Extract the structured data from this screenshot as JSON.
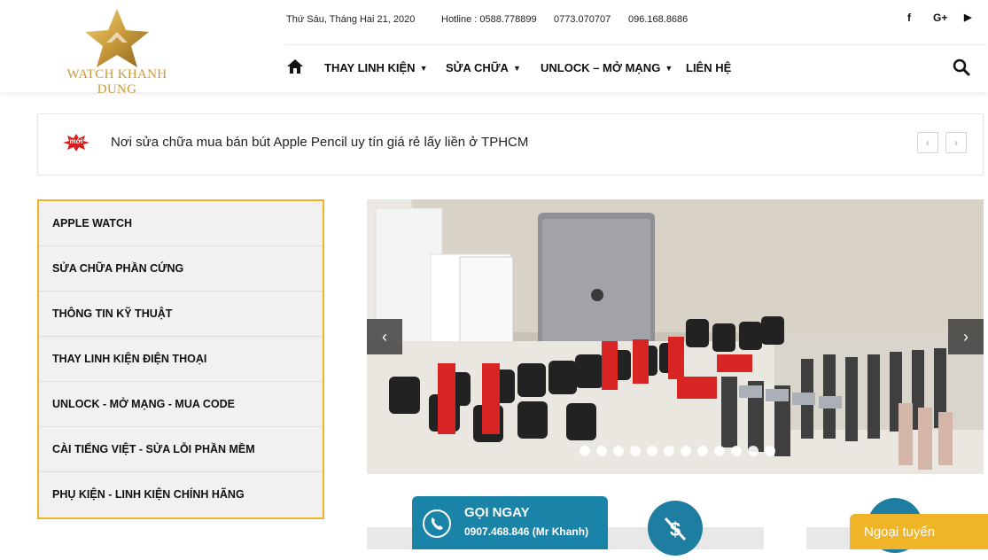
{
  "brand": {
    "logo_text": "WATCH KHANH DUNG"
  },
  "topbar": {
    "date": "Thứ Sáu, Tháng Hai 21, 2020",
    "hotline": "Hotline : 0588.778899",
    "phone2": "0773.070707",
    "phone3": "096.168.8686",
    "social": [
      "f",
      "G+",
      "▶"
    ]
  },
  "nav": {
    "items": [
      {
        "label": "THAY LINH KIỆN",
        "has_dropdown": true
      },
      {
        "label": "SỬA CHỮA",
        "has_dropdown": true
      },
      {
        "label": "UNLOCK – MỞ MẠNG",
        "has_dropdown": true
      },
      {
        "label": "LIÊN HỆ",
        "has_dropdown": false
      }
    ],
    "home_icon": "home-icon",
    "search_icon": "search-icon"
  },
  "ticker": {
    "badge": "mới",
    "headline": "Nơi sửa chữa mua bán bút Apple Pencil uy tín giá rẻ lấy liền ở TPHCM",
    "prev": "‹",
    "next": "›"
  },
  "sidebar": {
    "items": [
      "APPLE WATCH",
      "SỬA CHỮA PHẦN CỨNG",
      "THÔNG TIN KỸ THUẬT",
      "THAY LINH KIỆN ĐIỆN THOẠI",
      "UNLOCK - MỞ MẠNG - MUA CODE",
      "CÀI TIẾNG VIỆT - SỬA LỖI PHẦN MỀM",
      "PHỤ KIỆN - LINH KIỆN CHÍNH HÃNG"
    ]
  },
  "slider": {
    "prev": "‹",
    "next": "›",
    "dot_count": 12,
    "active_dot": 1
  },
  "call_widget": {
    "title": "GỌI NGAY",
    "number": "0907.468.846 (Mr Khanh)"
  },
  "chat_widget": {
    "label": "Ngoại tuyến"
  },
  "colors": {
    "accent": "#f0b429",
    "call": "#1a83a8",
    "gold": "#c99a3b"
  }
}
